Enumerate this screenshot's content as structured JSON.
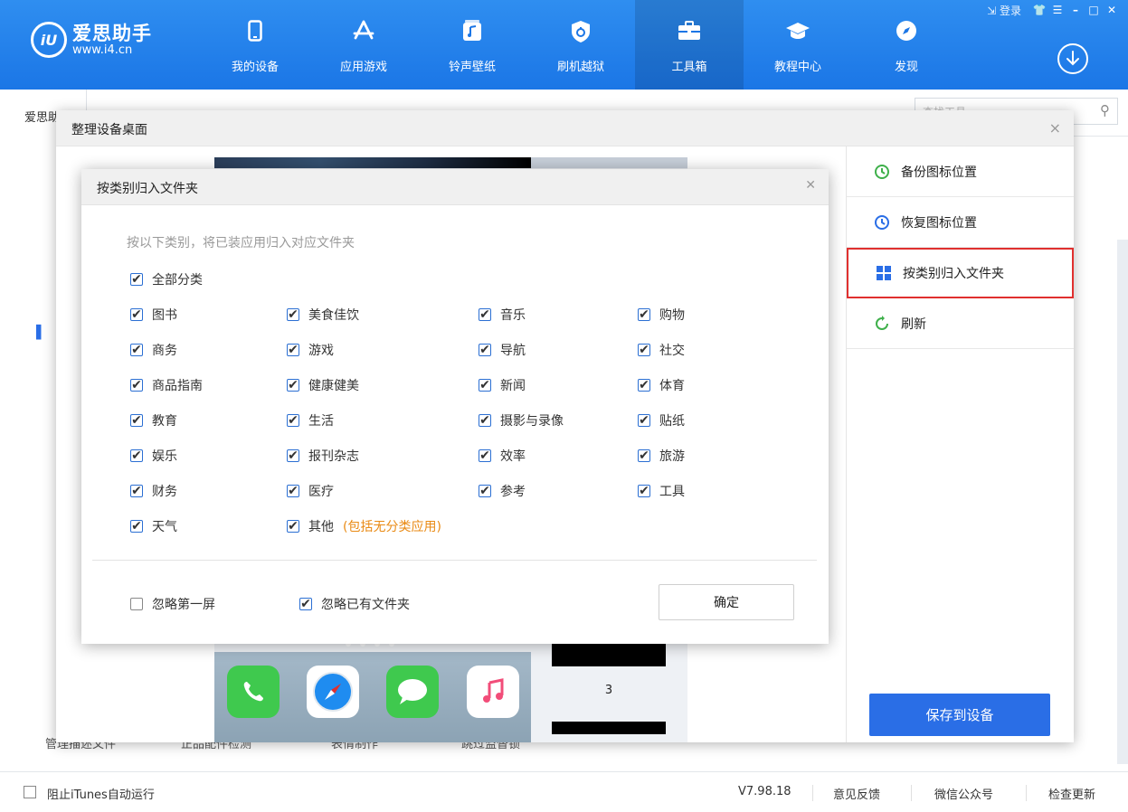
{
  "app": {
    "brand_name": "爱思助手",
    "brand_url": "www.i4.cn",
    "logo_mark": "iU",
    "nav": [
      {
        "label": "我的设备",
        "icon": "phone-icon"
      },
      {
        "label": "应用游戏",
        "icon": "app-store-icon"
      },
      {
        "label": "铃声壁纸",
        "icon": "music-icon"
      },
      {
        "label": "刷机越狱",
        "icon": "shield-icon"
      },
      {
        "label": "工具箱",
        "icon": "toolbox-icon",
        "active": true
      },
      {
        "label": "教程中心",
        "icon": "graduation-cap-icon"
      },
      {
        "label": "发现",
        "icon": "compass-icon"
      }
    ],
    "login_label": "登录",
    "accent_color": "#1b76e6"
  },
  "background": {
    "tab_label": "爱思助手",
    "search_placeholder": "查找工具",
    "bottom_labels": [
      "管理描述文件",
      "正品配件检测",
      "表情制作",
      "跳过监督锁"
    ]
  },
  "statusbar": {
    "itunes_label": "阻止iTunes自动运行",
    "version": "V7.98.18",
    "feedback": "意见反馈",
    "wechat": "微信公众号",
    "update": "检查更新"
  },
  "organizer_dialog": {
    "title": "整理设备桌面",
    "actions": [
      {
        "label": "备份图标位置",
        "icon": "backup-icon"
      },
      {
        "label": "恢复图标位置",
        "icon": "restore-icon"
      },
      {
        "label": "按类别归入文件夹",
        "icon": "grid-icon",
        "highlighted": true
      },
      {
        "label": "刷新",
        "icon": "refresh-icon"
      }
    ],
    "save_label": "保存到设备",
    "page_number": "3",
    "dock_apps": [
      "phone-app-icon",
      "safari-app-icon",
      "messages-app-icon",
      "music-app-icon"
    ]
  },
  "category_dialog": {
    "title": "按类别归入文件夹",
    "hint": "按以下类别，将已装应用归入对应文件夹",
    "all_label": "全部分类",
    "categories": [
      [
        "图书",
        "美食佳饮",
        "音乐",
        "购物"
      ],
      [
        "商务",
        "游戏",
        "导航",
        "社交"
      ],
      [
        "商品指南",
        "健康健美",
        "新闻",
        "体育"
      ],
      [
        "教育",
        "生活",
        "摄影与录像",
        "贴纸"
      ],
      [
        "娱乐",
        "报刊杂志",
        "效率",
        "旅游"
      ],
      [
        "财务",
        "医疗",
        "参考",
        "工具"
      ],
      [
        "天气",
        "其他"
      ]
    ],
    "other_note": "(包括无分类应用)",
    "ignore_first_screen": "忽略第一屏",
    "ignore_first_screen_checked": false,
    "ignore_existing_folders": "忽略已有文件夹",
    "ignore_existing_folders_checked": true,
    "confirm_label": "确定"
  }
}
